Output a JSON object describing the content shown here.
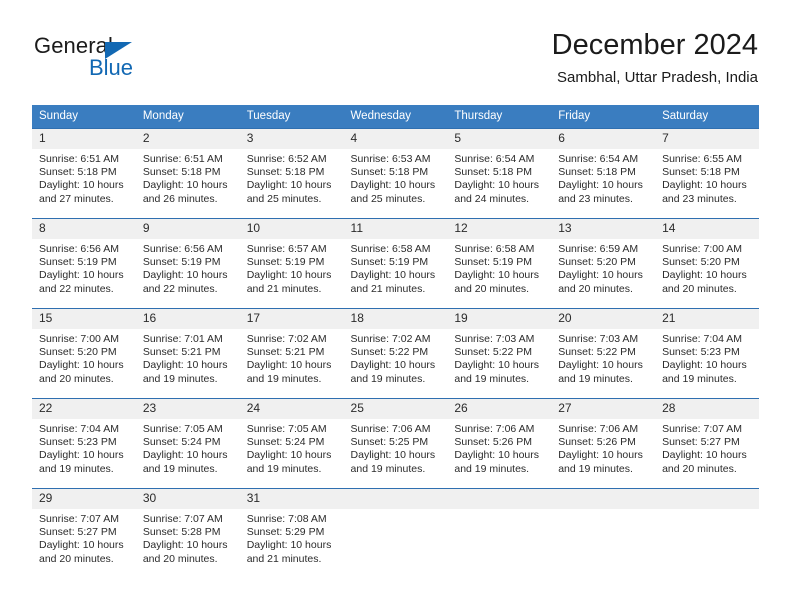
{
  "logo": {
    "word_one": "General",
    "word_two": "Blue",
    "icon": "triangle-flag-icon"
  },
  "header": {
    "title": "December 2024",
    "subtitle": "Sambhal, Uttar Pradesh, India"
  },
  "colors": {
    "header_blue": "#3a7dc0",
    "row_rule_blue": "#2f6fb0",
    "daynum_band": "#f0f0f0",
    "logo_blue": "#1268b3",
    "text": "#2b2b2b"
  },
  "calendar": {
    "weekday_headers": [
      "Sunday",
      "Monday",
      "Tuesday",
      "Wednesday",
      "Thursday",
      "Friday",
      "Saturday"
    ],
    "labels": {
      "sunrise": "Sunrise:",
      "sunset": "Sunset:",
      "daylight": "Daylight:"
    },
    "weeks": [
      [
        {
          "day": "1",
          "sunrise": "Sunrise: 6:51 AM",
          "sunset": "Sunset: 5:18 PM",
          "daylight_line1": "Daylight: 10 hours",
          "daylight_line2": "and 27 minutes."
        },
        {
          "day": "2",
          "sunrise": "Sunrise: 6:51 AM",
          "sunset": "Sunset: 5:18 PM",
          "daylight_line1": "Daylight: 10 hours",
          "daylight_line2": "and 26 minutes."
        },
        {
          "day": "3",
          "sunrise": "Sunrise: 6:52 AM",
          "sunset": "Sunset: 5:18 PM",
          "daylight_line1": "Daylight: 10 hours",
          "daylight_line2": "and 25 minutes."
        },
        {
          "day": "4",
          "sunrise": "Sunrise: 6:53 AM",
          "sunset": "Sunset: 5:18 PM",
          "daylight_line1": "Daylight: 10 hours",
          "daylight_line2": "and 25 minutes."
        },
        {
          "day": "5",
          "sunrise": "Sunrise: 6:54 AM",
          "sunset": "Sunset: 5:18 PM",
          "daylight_line1": "Daylight: 10 hours",
          "daylight_line2": "and 24 minutes."
        },
        {
          "day": "6",
          "sunrise": "Sunrise: 6:54 AM",
          "sunset": "Sunset: 5:18 PM",
          "daylight_line1": "Daylight: 10 hours",
          "daylight_line2": "and 23 minutes."
        },
        {
          "day": "7",
          "sunrise": "Sunrise: 6:55 AM",
          "sunset": "Sunset: 5:18 PM",
          "daylight_line1": "Daylight: 10 hours",
          "daylight_line2": "and 23 minutes."
        }
      ],
      [
        {
          "day": "8",
          "sunrise": "Sunrise: 6:56 AM",
          "sunset": "Sunset: 5:19 PM",
          "daylight_line1": "Daylight: 10 hours",
          "daylight_line2": "and 22 minutes."
        },
        {
          "day": "9",
          "sunrise": "Sunrise: 6:56 AM",
          "sunset": "Sunset: 5:19 PM",
          "daylight_line1": "Daylight: 10 hours",
          "daylight_line2": "and 22 minutes."
        },
        {
          "day": "10",
          "sunrise": "Sunrise: 6:57 AM",
          "sunset": "Sunset: 5:19 PM",
          "daylight_line1": "Daylight: 10 hours",
          "daylight_line2": "and 21 minutes."
        },
        {
          "day": "11",
          "sunrise": "Sunrise: 6:58 AM",
          "sunset": "Sunset: 5:19 PM",
          "daylight_line1": "Daylight: 10 hours",
          "daylight_line2": "and 21 minutes."
        },
        {
          "day": "12",
          "sunrise": "Sunrise: 6:58 AM",
          "sunset": "Sunset: 5:19 PM",
          "daylight_line1": "Daylight: 10 hours",
          "daylight_line2": "and 20 minutes."
        },
        {
          "day": "13",
          "sunrise": "Sunrise: 6:59 AM",
          "sunset": "Sunset: 5:20 PM",
          "daylight_line1": "Daylight: 10 hours",
          "daylight_line2": "and 20 minutes."
        },
        {
          "day": "14",
          "sunrise": "Sunrise: 7:00 AM",
          "sunset": "Sunset: 5:20 PM",
          "daylight_line1": "Daylight: 10 hours",
          "daylight_line2": "and 20 minutes."
        }
      ],
      [
        {
          "day": "15",
          "sunrise": "Sunrise: 7:00 AM",
          "sunset": "Sunset: 5:20 PM",
          "daylight_line1": "Daylight: 10 hours",
          "daylight_line2": "and 20 minutes."
        },
        {
          "day": "16",
          "sunrise": "Sunrise: 7:01 AM",
          "sunset": "Sunset: 5:21 PM",
          "daylight_line1": "Daylight: 10 hours",
          "daylight_line2": "and 19 minutes."
        },
        {
          "day": "17",
          "sunrise": "Sunrise: 7:02 AM",
          "sunset": "Sunset: 5:21 PM",
          "daylight_line1": "Daylight: 10 hours",
          "daylight_line2": "and 19 minutes."
        },
        {
          "day": "18",
          "sunrise": "Sunrise: 7:02 AM",
          "sunset": "Sunset: 5:22 PM",
          "daylight_line1": "Daylight: 10 hours",
          "daylight_line2": "and 19 minutes."
        },
        {
          "day": "19",
          "sunrise": "Sunrise: 7:03 AM",
          "sunset": "Sunset: 5:22 PM",
          "daylight_line1": "Daylight: 10 hours",
          "daylight_line2": "and 19 minutes."
        },
        {
          "day": "20",
          "sunrise": "Sunrise: 7:03 AM",
          "sunset": "Sunset: 5:22 PM",
          "daylight_line1": "Daylight: 10 hours",
          "daylight_line2": "and 19 minutes."
        },
        {
          "day": "21",
          "sunrise": "Sunrise: 7:04 AM",
          "sunset": "Sunset: 5:23 PM",
          "daylight_line1": "Daylight: 10 hours",
          "daylight_line2": "and 19 minutes."
        }
      ],
      [
        {
          "day": "22",
          "sunrise": "Sunrise: 7:04 AM",
          "sunset": "Sunset: 5:23 PM",
          "daylight_line1": "Daylight: 10 hours",
          "daylight_line2": "and 19 minutes."
        },
        {
          "day": "23",
          "sunrise": "Sunrise: 7:05 AM",
          "sunset": "Sunset: 5:24 PM",
          "daylight_line1": "Daylight: 10 hours",
          "daylight_line2": "and 19 minutes."
        },
        {
          "day": "24",
          "sunrise": "Sunrise: 7:05 AM",
          "sunset": "Sunset: 5:24 PM",
          "daylight_line1": "Daylight: 10 hours",
          "daylight_line2": "and 19 minutes."
        },
        {
          "day": "25",
          "sunrise": "Sunrise: 7:06 AM",
          "sunset": "Sunset: 5:25 PM",
          "daylight_line1": "Daylight: 10 hours",
          "daylight_line2": "and 19 minutes."
        },
        {
          "day": "26",
          "sunrise": "Sunrise: 7:06 AM",
          "sunset": "Sunset: 5:26 PM",
          "daylight_line1": "Daylight: 10 hours",
          "daylight_line2": "and 19 minutes."
        },
        {
          "day": "27",
          "sunrise": "Sunrise: 7:06 AM",
          "sunset": "Sunset: 5:26 PM",
          "daylight_line1": "Daylight: 10 hours",
          "daylight_line2": "and 19 minutes."
        },
        {
          "day": "28",
          "sunrise": "Sunrise: 7:07 AM",
          "sunset": "Sunset: 5:27 PM",
          "daylight_line1": "Daylight: 10 hours",
          "daylight_line2": "and 20 minutes."
        }
      ],
      [
        {
          "day": "29",
          "sunrise": "Sunrise: 7:07 AM",
          "sunset": "Sunset: 5:27 PM",
          "daylight_line1": "Daylight: 10 hours",
          "daylight_line2": "and 20 minutes."
        },
        {
          "day": "30",
          "sunrise": "Sunrise: 7:07 AM",
          "sunset": "Sunset: 5:28 PM",
          "daylight_line1": "Daylight: 10 hours",
          "daylight_line2": "and 20 minutes."
        },
        {
          "day": "31",
          "sunrise": "Sunrise: 7:08 AM",
          "sunset": "Sunset: 5:29 PM",
          "daylight_line1": "Daylight: 10 hours",
          "daylight_line2": "and 21 minutes."
        },
        {
          "day": "",
          "sunrise": "",
          "sunset": "",
          "daylight_line1": "",
          "daylight_line2": ""
        },
        {
          "day": "",
          "sunrise": "",
          "sunset": "",
          "daylight_line1": "",
          "daylight_line2": ""
        },
        {
          "day": "",
          "sunrise": "",
          "sunset": "",
          "daylight_line1": "",
          "daylight_line2": ""
        },
        {
          "day": "",
          "sunrise": "",
          "sunset": "",
          "daylight_line1": "",
          "daylight_line2": ""
        }
      ]
    ]
  }
}
